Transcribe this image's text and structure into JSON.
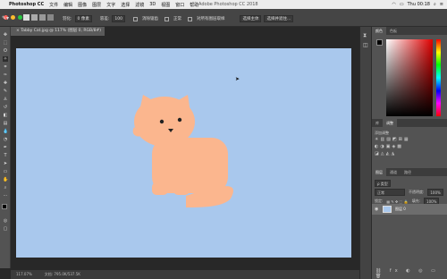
{
  "menubar": {
    "app": "Photoshop CC",
    "items": [
      "文件",
      "编辑",
      "图像",
      "图层",
      "文字",
      "选择",
      "滤镜",
      "3D",
      "视图",
      "窗口",
      "帮助"
    ],
    "window_title": "Adobe Photoshop CC 2018",
    "clock": "Thu 00:18"
  },
  "options": {
    "feather_label": "羽化:",
    "feather_value": "0 像素",
    "antialias_label": "消除锯齿",
    "style_label": "样式:",
    "style_value": "正常",
    "width_label": "宽度:",
    "height_label": "高度:",
    "select_mask": "选择并遮住...",
    "mode_label": "图层:",
    "mode_value": "正常",
    "tolerance_label": "容差:",
    "tolerance_value": "100",
    "sample_label": "对所有图层取样",
    "refine": "调整边缘",
    "select_subject": "选择主体"
  },
  "document": {
    "tab_label": "Tabby Cat.jpg @ 117% (图层 0, RGB/8#)",
    "zoom": "117.07%",
    "doc_info": "文档: 795.0K/537.5K"
  },
  "panels": {
    "color_tab": "颜色",
    "swatches_tab": "色板",
    "adjustments_tab": "库",
    "adjustments_tab2": "调整",
    "add_adjustment": "添加调整",
    "layers_tab": "图层",
    "channels_tab": "通道",
    "paths_tab": "路径",
    "kind_label": "ρ 类型",
    "blend_mode": "正常",
    "opacity_label": "不透明度:",
    "opacity_value": "100%",
    "lock_label": "锁定:",
    "fill_label": "填充:",
    "fill_value": "100%",
    "layer_name": "图层 0"
  },
  "colors": {
    "canvas_bg": "#a9c8ed",
    "cat": "#fbb68e",
    "panel": "#535353"
  }
}
